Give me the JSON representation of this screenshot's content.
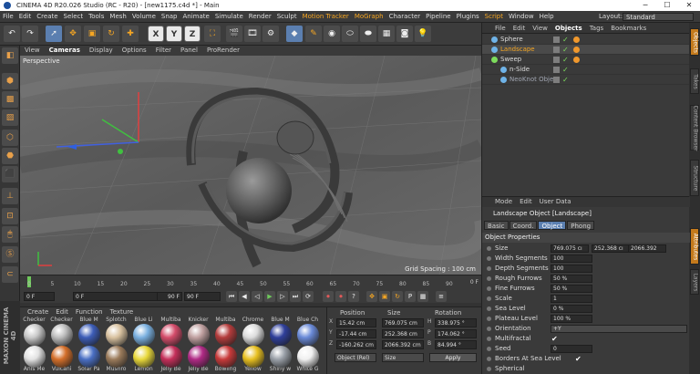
{
  "window": {
    "title": "CINEMA 4D R20.026 Studio (RC - R20) - [new1175.c4d *] - Main",
    "min": "─",
    "max": "☐",
    "close": "✕"
  },
  "menu": {
    "items": [
      "File",
      "Edit",
      "Create",
      "Select",
      "Tools",
      "Mesh",
      "Volume",
      "Snap",
      "Animate",
      "Simulate",
      "Render",
      "Sculpt",
      "Motion Tracker",
      "MoGraph",
      "Character",
      "Pipeline",
      "Plugins",
      "Script",
      "Window",
      "Help"
    ],
    "highlighted": [
      "Motion Tracker",
      "MoGraph",
      "Script"
    ],
    "layout_label": "Layout:",
    "layout_value": "Standard"
  },
  "toolbar": {
    "x": "X",
    "y": "Y",
    "z": "Z"
  },
  "viewport": {
    "menu": [
      "View",
      "Cameras",
      "Display",
      "Options",
      "Filter",
      "Panel",
      "ProRender"
    ],
    "selected_menu": "Cameras",
    "camera": "Perspective",
    "grid_spacing": "Grid Spacing : 100 cm"
  },
  "timeline": {
    "ticks": [
      "0",
      "5",
      "10",
      "15",
      "20",
      "25",
      "30",
      "35",
      "40",
      "45",
      "50",
      "55",
      "60",
      "65",
      "70",
      "75",
      "80",
      "85",
      "90"
    ],
    "frame_right": "0 F",
    "start": "0 F",
    "current": "0 F",
    "end": "90 F",
    "end2": "90 F"
  },
  "brand": {
    "logo": "MAXON CINEMA 4D"
  },
  "materials": {
    "menu": [
      "Create",
      "Edit",
      "Function",
      "Texture"
    ],
    "row1": [
      "Checker",
      "Checker",
      "Blue M",
      "Splotch",
      "Blue Li",
      "Multiba",
      "Knicker",
      "Multiba",
      "Chrome",
      "Blue M",
      "Blue Ch"
    ],
    "row2": [
      "Anis Me",
      "Vulcani",
      "Solar Pa",
      "Mushro",
      "Lemon",
      "Jelly Be",
      "Jelly Be",
      "Bowling",
      "Yellow",
      "Shiny w",
      "White G"
    ],
    "colors1": [
      "#c9c9c9",
      "#bdbdbd",
      "#3d5db8",
      "#d9c2a0",
      "#7ab0e0",
      "#d44c6a",
      "#c0a0a0",
      "#b43c3c",
      "#dcdcdc",
      "#2f3f9a",
      "#6a8ad8"
    ],
    "colors2": [
      "#e3e3e3",
      "#d46f2a",
      "#4a6fc4",
      "#9b7b5b",
      "#e8d83a",
      "#c52f5a",
      "#b02a85",
      "#c83a3a",
      "#e8c020",
      "#9aa0a8",
      "#f0f0f0"
    ]
  },
  "coords": {
    "headers": {
      "position": "Position",
      "size": "Size",
      "rotation": "Rotation"
    },
    "rows": [
      {
        "axis": "X",
        "pos": "15.42 cm",
        "size": "769.075 cm",
        "rot_axis": "H",
        "rot": "338.975 °"
      },
      {
        "axis": "Y",
        "pos": "-17.44 cm",
        "size": "252.368 cm",
        "rot_axis": "P",
        "rot": "174.062 °"
      },
      {
        "axis": "Z",
        "pos": "-160.262 cm",
        "size": "2066.392 cm",
        "rot_axis": "B",
        "rot": "84.994 °"
      }
    ],
    "mode": "Object (Rel)",
    "size_mode": "Size",
    "apply": "Apply"
  },
  "objects": {
    "tabs": [
      "File",
      "Edit",
      "View",
      "Objects",
      "Tags",
      "Bookmarks"
    ],
    "selected_tab": "Objects",
    "list": [
      {
        "name": "Sphere",
        "style": "normal",
        "indent": 1,
        "icon_color": "#6fb3e8",
        "tag": true
      },
      {
        "name": "Landscape",
        "style": "orange",
        "indent": 1,
        "icon_color": "#6fb3e8",
        "tag": true
      },
      {
        "name": "Sweep",
        "style": "normal",
        "indent": 1,
        "icon_color": "#7ddc5c",
        "tag": true
      },
      {
        "name": "n-Side",
        "style": "normal",
        "indent": 2,
        "icon_color": "#6fb3e8",
        "tag": false
      },
      {
        "name": "NeoKnot Object",
        "style": "grey",
        "indent": 2,
        "icon_color": "#6fb3e8",
        "tag": false
      }
    ]
  },
  "sidetabs": [
    "Objects",
    "Takes",
    "Content Browser",
    "Structure",
    "Attributes",
    "Layers"
  ],
  "attributes": {
    "menu": [
      "Mode",
      "Edit",
      "User Data"
    ],
    "title": "Landscape Object [Landscape]",
    "tabs": [
      "Basic",
      "Coord.",
      "Object",
      "Phong"
    ],
    "selected_tab": "Object",
    "section": "Object Properties",
    "size": {
      "label": "Size",
      "v1": "769.075 cı",
      "v2": "252.368 cı",
      "v3": "2066.392"
    },
    "fields": [
      {
        "label": "Width Segments",
        "value": "100"
      },
      {
        "label": "Depth Segments",
        "value": "100"
      },
      {
        "label": "Rough Furrows",
        "value": "50 %"
      },
      {
        "label": "Fine Furrows",
        "value": "50 %"
      },
      {
        "label": "Scale",
        "value": "1"
      },
      {
        "label": "Sea Level",
        "value": "0 %"
      },
      {
        "label": "Plateau Level",
        "value": "100 %"
      }
    ],
    "orientation": {
      "label": "Orientation",
      "value": "+Y"
    },
    "multifractal": {
      "label": "Multifractal",
      "checked": "✔"
    },
    "seed": {
      "label": "Seed",
      "value": "0"
    },
    "borders": {
      "label": "Borders At Sea Level",
      "checked": "✔"
    },
    "spherical": {
      "label": "Spherical"
    }
  }
}
